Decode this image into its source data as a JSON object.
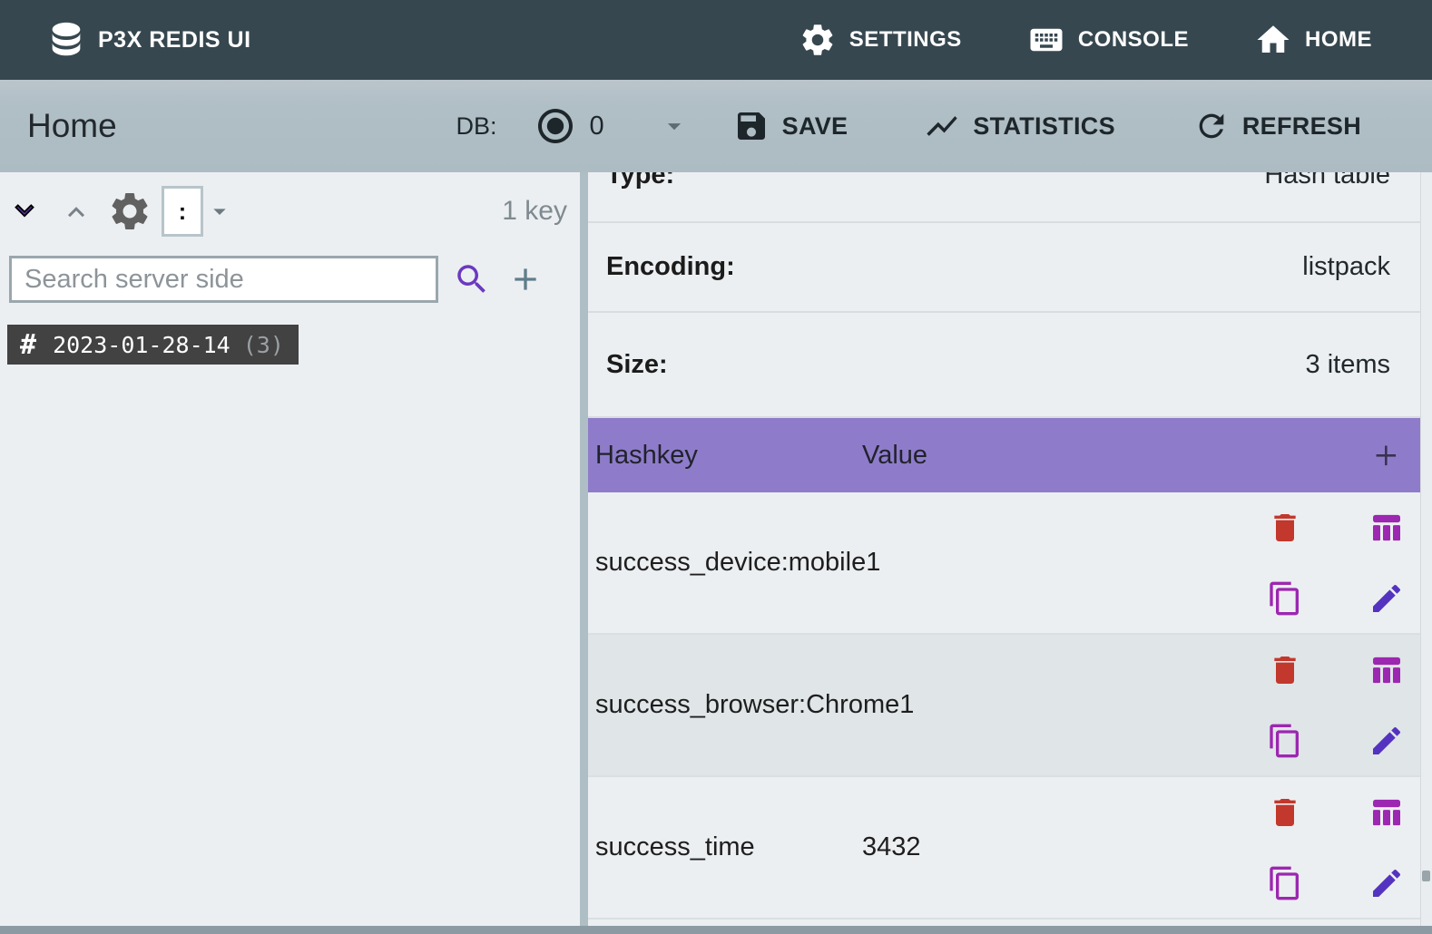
{
  "app_bar": {
    "title": "P3X REDIS UI",
    "nav": {
      "settings": "SETTINGS",
      "console": "CONSOLE",
      "home": "HOME"
    }
  },
  "toolbar": {
    "page_title": "Home",
    "db_label": "DB:",
    "db_value": "0",
    "save_label": "SAVE",
    "statistics_label": "STATISTICS",
    "refresh_label": "REFRESH"
  },
  "sidebar": {
    "separator_value": ":",
    "key_count": "1 key",
    "search_placeholder": "Search server side",
    "tree": {
      "hash_symbol": "#",
      "label": "2023-01-28-14",
      "count": "(3)"
    }
  },
  "details": {
    "rows": [
      {
        "label": "Type:",
        "value": "Hash table"
      },
      {
        "label": "Encoding:",
        "value": "listpack"
      },
      {
        "label": "Size:",
        "value": "3  items"
      }
    ]
  },
  "hash_table": {
    "columns": {
      "hashkey": "Hashkey",
      "value": "Value"
    },
    "rows": [
      {
        "hashkey": "success_device:mobile1",
        "value": ""
      },
      {
        "hashkey": "success_browser:Chrome1",
        "value": ""
      },
      {
        "hashkey": "success_time",
        "value": "3432"
      }
    ]
  },
  "colors": {
    "app_bar_bg": "#37474F",
    "toolbar_bg": "#B0BEC5",
    "panel_bg": "#ECEFF1",
    "alt_row_bg": "#E0E5E8",
    "hash_header_bg": "#8E7CCB",
    "accent_purple": "#5E35B1",
    "delete_red": "#C2382C",
    "magenta_icon": "#9C27B0",
    "tree_item_bg": "#424242"
  }
}
